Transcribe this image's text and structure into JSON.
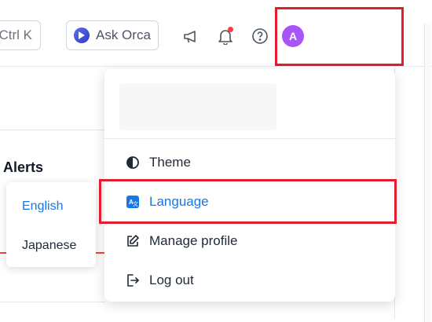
{
  "topbar": {
    "search_shortcut": "Ctrl K",
    "ask_label": "Ask Orca",
    "avatar_initial": "A"
  },
  "page": {
    "alerts_title": "Alerts"
  },
  "language_menu": {
    "items": [
      {
        "label": "English",
        "selected": true
      },
      {
        "label": "Japanese",
        "selected": false
      }
    ]
  },
  "profile_menu": {
    "items": [
      {
        "label": "Theme",
        "icon": "theme-icon"
      },
      {
        "label": "Language",
        "icon": "language-icon",
        "active": true
      },
      {
        "label": "Manage profile",
        "icon": "edit-icon"
      },
      {
        "label": "Log out",
        "icon": "logout-icon"
      }
    ]
  },
  "colors": {
    "accent": "#1677e6",
    "avatar": "#a855f7",
    "highlight": "#e11d2f",
    "notification_dot": "#ef4444"
  }
}
